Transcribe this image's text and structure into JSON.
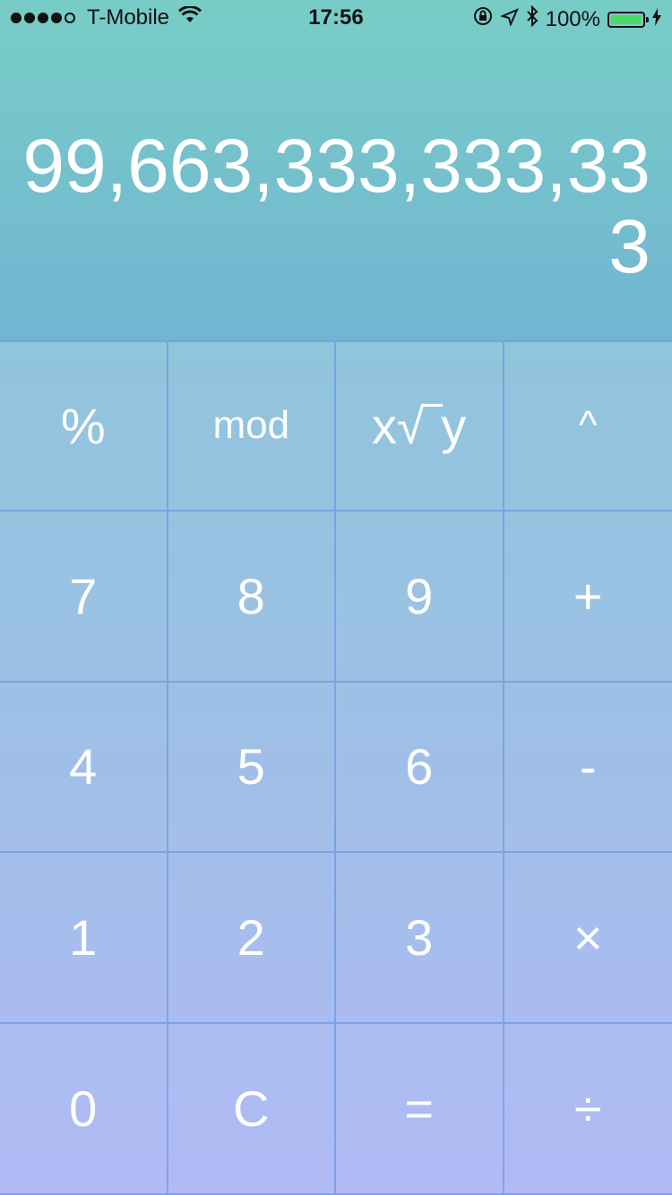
{
  "status": {
    "carrier": "T-Mobile",
    "time": "17:56",
    "battery": "100%",
    "icons": [
      "wifi-icon",
      "rotation-lock-icon",
      "location-icon",
      "bluetooth-icon",
      "charging-icon"
    ]
  },
  "display": {
    "line1": "99,663,333,333,33",
    "line2": "3"
  },
  "keys": [
    "%",
    "mod",
    "x√‾y",
    "^",
    "7",
    "8",
    "9",
    "+",
    "4",
    "5",
    "6",
    "-",
    "1",
    "2",
    "3",
    "×",
    "0",
    "C",
    "=",
    "÷"
  ]
}
